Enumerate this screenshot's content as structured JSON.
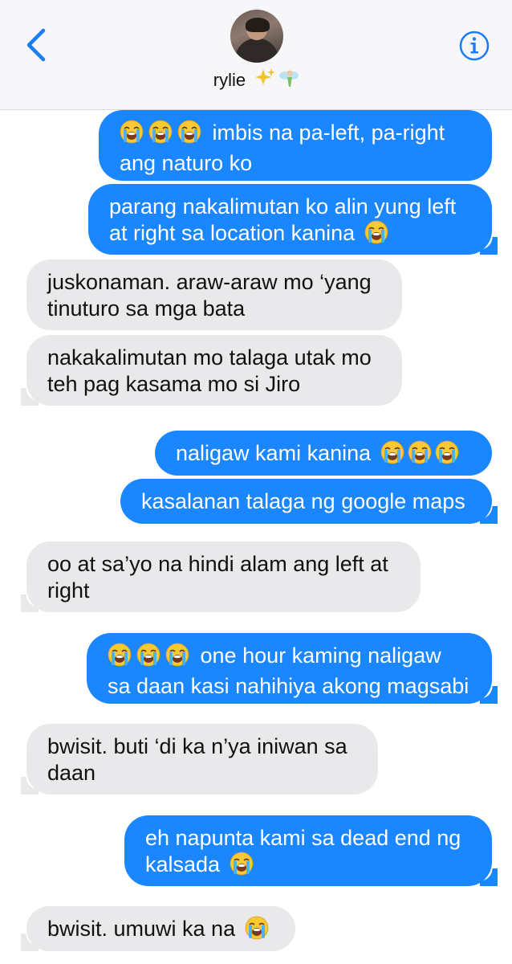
{
  "header": {
    "contact_name": "rylie",
    "contact_emoji_name": "sparkles-fairy-emoji"
  },
  "messages": [
    {
      "from": "me",
      "lines": [
        "imbis na pa-left, pa-right",
        "ang naturo ko"
      ],
      "leading_emoji_count": 3
    },
    {
      "from": "me",
      "lines": [
        "parang nakalimutan ko alin yung left",
        "at right sa location kanina"
      ],
      "trailing_emoji_count": 1
    },
    {
      "from": "them",
      "lines": [
        "juskonaman. araw-araw mo ‘yang",
        "tinuturo sa mga bata"
      ]
    },
    {
      "from": "them",
      "lines": [
        "nakakalimutan mo talaga utak mo",
        "teh pag kasama mo si Jiro"
      ]
    },
    {
      "from": "me",
      "lines": [
        "naligaw kami kanina"
      ],
      "trailing_emoji_count": 3
    },
    {
      "from": "me",
      "lines": [
        "kasalanan talaga ng google maps"
      ]
    },
    {
      "from": "them",
      "lines": [
        "oo at sa’yo na hindi alam ang left at",
        "right"
      ]
    },
    {
      "from": "me",
      "lines": [
        "one hour kaming naligaw",
        "sa daan kasi nahihiya akong magsabi"
      ],
      "leading_emoji_count": 3
    },
    {
      "from": "them",
      "lines": [
        "bwisit. buti ‘di ka n’ya iniwan sa",
        "daan"
      ]
    },
    {
      "from": "me",
      "lines": [
        "eh napunta kami sa dead end ng",
        "kalsada"
      ],
      "trailing_emoji_count": 1
    },
    {
      "from": "them",
      "lines": [
        "bwisit. umuwi ka na"
      ],
      "trailing_emoji_count": 1
    }
  ],
  "emoji": {
    "name": "loudly-crying-face-emoji"
  },
  "colors": {
    "sent": "#1a86ff",
    "received": "#e9e9eb",
    "accent": "#1a7cf5"
  }
}
